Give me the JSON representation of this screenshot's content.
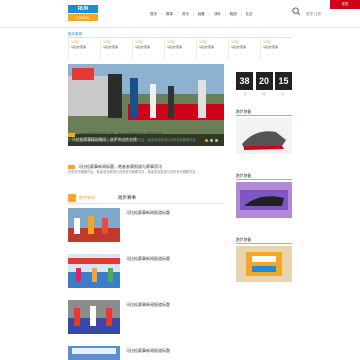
{
  "header": {
    "logo_top": "RUN",
    "logo_bottom": "CHINA",
    "nav": [
      "首页",
      "赛事",
      "资讯",
      "装备",
      "训练",
      "跑团",
      "社区"
    ],
    "user_link": "登录 注册",
    "red_button": "发布"
  },
  "subbar": {
    "crumb": "跑步新闻"
  },
  "races": [
    {
      "date": "12月",
      "name": "马拉松赛事"
    },
    {
      "date": "12月",
      "name": "马拉松赛事"
    },
    {
      "date": "12月",
      "name": "马拉松赛事"
    },
    {
      "date": "12月",
      "name": "马拉松赛事"
    },
    {
      "date": "12月",
      "name": "马拉松赛事"
    },
    {
      "date": "12月",
      "name": "马拉松赛事"
    },
    {
      "date": "12月",
      "name": "马拉松赛事"
    }
  ],
  "hero": {
    "caption": "马拉松赛事精彩瞬间，选手冲过终点线"
  },
  "countdown": {
    "title": "",
    "values": [
      "38",
      "20",
      "15"
    ],
    "labels": [
      "天",
      "时",
      "分"
    ]
  },
  "news": [
    {
      "title": "马拉松赛事新闻标题，跑者参赛报道与赛事资讯",
      "summary": "赛事资讯摘要内容，跑者参赛报道与赛事资讯摘要内容，跑者参赛报道与赛事资讯摘要内容。"
    },
    {
      "title": "马拉松赛事新闻标题，跑者参赛报道与赛事资讯",
      "summary": "赛事资讯摘要内容，跑者参赛报道与赛事资讯摘要内容，跑者参赛报道与赛事资讯摘要内容。"
    }
  ],
  "section": {
    "tag": "跑步新闻",
    "title": "跑步赛事"
  },
  "articles": [
    {
      "title": "马拉松赛事新闻报道标题",
      "meta": ""
    },
    {
      "title": "马拉松赛事新闻报道标题",
      "meta": ""
    },
    {
      "title": "马拉松赛事新闻报道标题",
      "meta": ""
    },
    {
      "title": "马拉松赛事新闻报道标题",
      "meta": ""
    }
  ],
  "sidebar": [
    {
      "head": "跑步装备",
      "label": ""
    },
    {
      "head": "跑步装备",
      "label": ""
    },
    {
      "head": "跑步装备",
      "label": ""
    }
  ],
  "colors": {
    "accent": "#f5a623",
    "brand": "#1a8fd8",
    "red": "#d0021b"
  }
}
